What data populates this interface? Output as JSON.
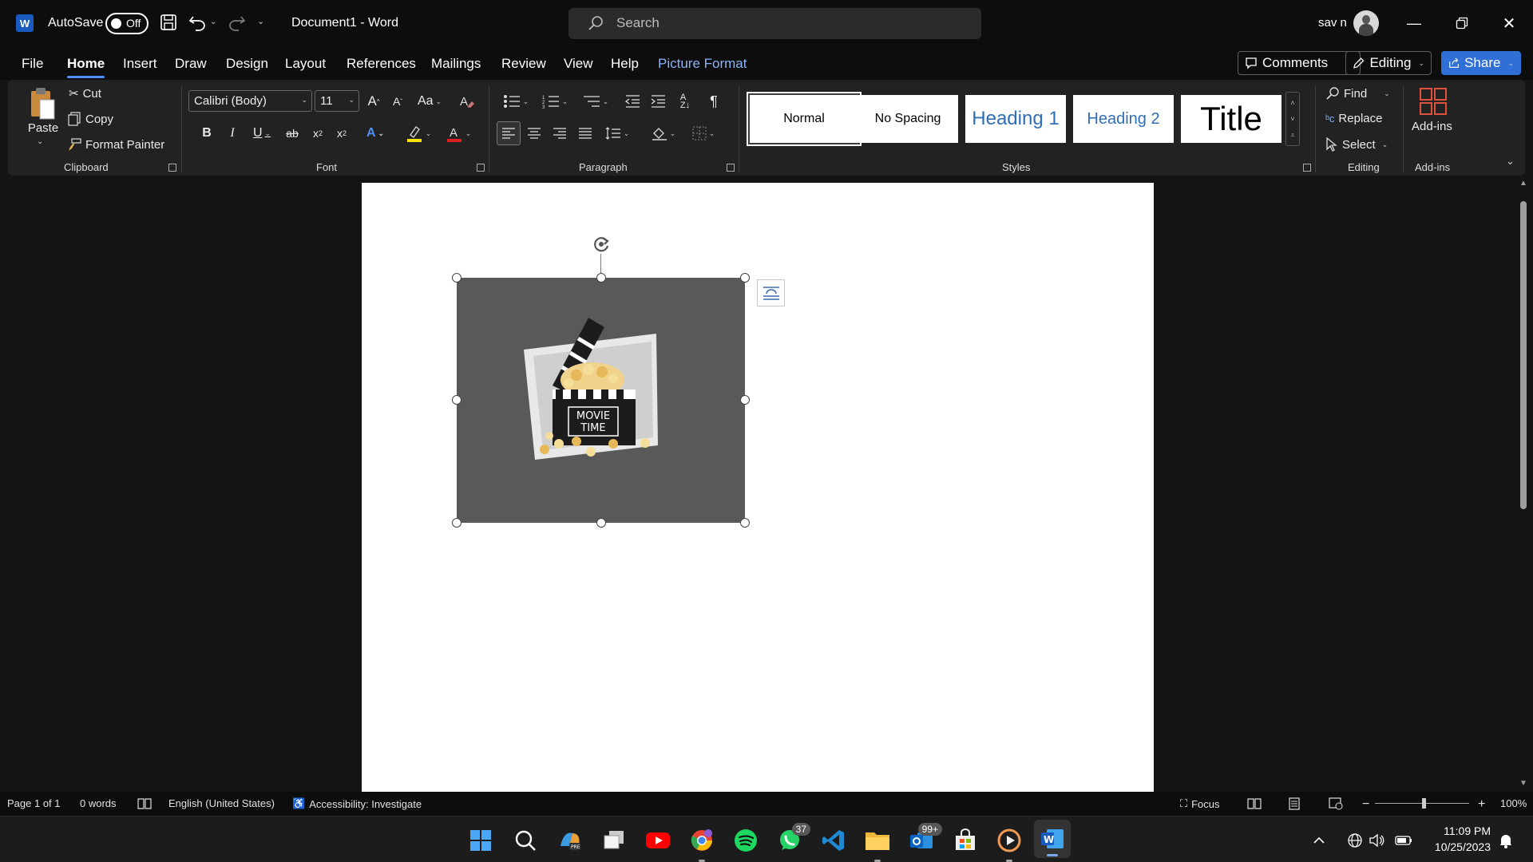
{
  "window": {
    "autosave_label": "AutoSave",
    "autosave_state": "Off",
    "doc_title": "Document1  -  Word",
    "search_placeholder": "Search",
    "user_name": "sav n"
  },
  "menu": {
    "tabs": [
      "File",
      "Home",
      "Insert",
      "Draw",
      "Design",
      "Layout",
      "References",
      "Mailings",
      "Review",
      "View",
      "Help",
      "Picture Format"
    ],
    "active_tab": "Home",
    "comments_label": "Comments",
    "editing_label": "Editing",
    "share_label": "Share"
  },
  "ribbon": {
    "clipboard": {
      "label": "Clipboard",
      "paste": "Paste",
      "cut": "Cut",
      "copy": "Copy",
      "format_painter": "Format Painter"
    },
    "font": {
      "label": "Font",
      "font_name": "Calibri (Body)",
      "font_size": "11"
    },
    "paragraph": {
      "label": "Paragraph"
    },
    "styles": {
      "label": "Styles",
      "items": [
        "Normal",
        "No Spacing",
        "Heading 1",
        "Heading 2",
        "Title"
      ]
    },
    "editing": {
      "label": "Editing",
      "find": "Find",
      "replace": "Replace",
      "select": "Select"
    },
    "addins": {
      "label": "Add-ins",
      "button": "Add-ins"
    }
  },
  "picture": {
    "caption_line1": "MOVIE",
    "caption_line2": "TIME"
  },
  "status": {
    "page": "Page 1 of 1",
    "words": "0 words",
    "language": "English (United States)",
    "accessibility": "Accessibility: Investigate",
    "focus": "Focus",
    "zoom": "100%"
  },
  "taskbar": {
    "whatsapp_badge": "37",
    "outlook_badge": "99+",
    "time": "11:09 PM",
    "date": "10/25/2023"
  },
  "colors": {
    "accent": "#2f6fd6",
    "word_blue": "#185abd",
    "picture_bg": "#595959"
  }
}
